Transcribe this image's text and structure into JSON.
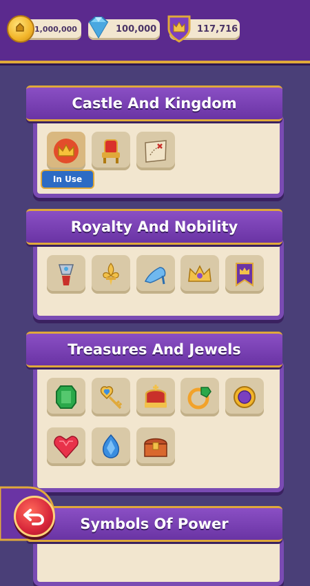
{
  "currencies": {
    "coins": "1,000,000",
    "gems": "100,000",
    "crowns": "117,716"
  },
  "categories": [
    {
      "title": "Castle And Kingdom",
      "items": [
        "crown-icon",
        "throne-icon",
        "treasure-map-icon"
      ],
      "in_use_label": "In Use"
    },
    {
      "title": "Royalty And Nobility",
      "items": [
        "trophy-icon",
        "fleur-de-lis-icon",
        "glass-slipper-icon",
        "jeweled-crown-icon",
        "banner-icon"
      ]
    },
    {
      "title": "Treasures And Jewels",
      "items": [
        "emerald-icon",
        "heart-key-icon",
        "royal-crown-icon",
        "gold-ring-icon",
        "amethyst-ring-icon",
        "ruby-heart-icon",
        "sapphire-icon",
        "treasure-chest-icon"
      ]
    },
    {
      "title": "Symbols Of Power",
      "items": []
    }
  ],
  "colors": {
    "background": "#4a3f78",
    "banner": "#7a45b8",
    "gold": "#e0a93a",
    "panel": "#f2e6cf"
  }
}
